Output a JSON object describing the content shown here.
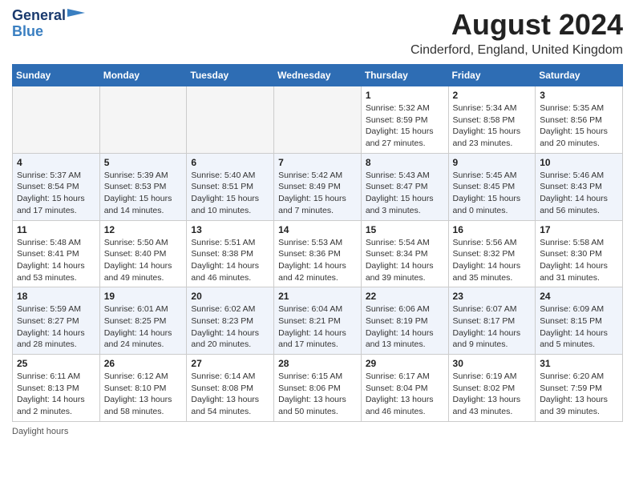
{
  "header": {
    "logo_general": "General",
    "logo_blue": "Blue",
    "main_title": "August 2024",
    "subtitle": "Cinderford, England, United Kingdom"
  },
  "days_of_week": [
    "Sunday",
    "Monday",
    "Tuesday",
    "Wednesday",
    "Thursday",
    "Friday",
    "Saturday"
  ],
  "weeks": [
    [
      {
        "day": "",
        "info": ""
      },
      {
        "day": "",
        "info": ""
      },
      {
        "day": "",
        "info": ""
      },
      {
        "day": "",
        "info": ""
      },
      {
        "day": "1",
        "info": "Sunrise: 5:32 AM\nSunset: 8:59 PM\nDaylight: 15 hours and 27 minutes."
      },
      {
        "day": "2",
        "info": "Sunrise: 5:34 AM\nSunset: 8:58 PM\nDaylight: 15 hours and 23 minutes."
      },
      {
        "day": "3",
        "info": "Sunrise: 5:35 AM\nSunset: 8:56 PM\nDaylight: 15 hours and 20 minutes."
      }
    ],
    [
      {
        "day": "4",
        "info": "Sunrise: 5:37 AM\nSunset: 8:54 PM\nDaylight: 15 hours and 17 minutes."
      },
      {
        "day": "5",
        "info": "Sunrise: 5:39 AM\nSunset: 8:53 PM\nDaylight: 15 hours and 14 minutes."
      },
      {
        "day": "6",
        "info": "Sunrise: 5:40 AM\nSunset: 8:51 PM\nDaylight: 15 hours and 10 minutes."
      },
      {
        "day": "7",
        "info": "Sunrise: 5:42 AM\nSunset: 8:49 PM\nDaylight: 15 hours and 7 minutes."
      },
      {
        "day": "8",
        "info": "Sunrise: 5:43 AM\nSunset: 8:47 PM\nDaylight: 15 hours and 3 minutes."
      },
      {
        "day": "9",
        "info": "Sunrise: 5:45 AM\nSunset: 8:45 PM\nDaylight: 15 hours and 0 minutes."
      },
      {
        "day": "10",
        "info": "Sunrise: 5:46 AM\nSunset: 8:43 PM\nDaylight: 14 hours and 56 minutes."
      }
    ],
    [
      {
        "day": "11",
        "info": "Sunrise: 5:48 AM\nSunset: 8:41 PM\nDaylight: 14 hours and 53 minutes."
      },
      {
        "day": "12",
        "info": "Sunrise: 5:50 AM\nSunset: 8:40 PM\nDaylight: 14 hours and 49 minutes."
      },
      {
        "day": "13",
        "info": "Sunrise: 5:51 AM\nSunset: 8:38 PM\nDaylight: 14 hours and 46 minutes."
      },
      {
        "day": "14",
        "info": "Sunrise: 5:53 AM\nSunset: 8:36 PM\nDaylight: 14 hours and 42 minutes."
      },
      {
        "day": "15",
        "info": "Sunrise: 5:54 AM\nSunset: 8:34 PM\nDaylight: 14 hours and 39 minutes."
      },
      {
        "day": "16",
        "info": "Sunrise: 5:56 AM\nSunset: 8:32 PM\nDaylight: 14 hours and 35 minutes."
      },
      {
        "day": "17",
        "info": "Sunrise: 5:58 AM\nSunset: 8:30 PM\nDaylight: 14 hours and 31 minutes."
      }
    ],
    [
      {
        "day": "18",
        "info": "Sunrise: 5:59 AM\nSunset: 8:27 PM\nDaylight: 14 hours and 28 minutes."
      },
      {
        "day": "19",
        "info": "Sunrise: 6:01 AM\nSunset: 8:25 PM\nDaylight: 14 hours and 24 minutes."
      },
      {
        "day": "20",
        "info": "Sunrise: 6:02 AM\nSunset: 8:23 PM\nDaylight: 14 hours and 20 minutes."
      },
      {
        "day": "21",
        "info": "Sunrise: 6:04 AM\nSunset: 8:21 PM\nDaylight: 14 hours and 17 minutes."
      },
      {
        "day": "22",
        "info": "Sunrise: 6:06 AM\nSunset: 8:19 PM\nDaylight: 14 hours and 13 minutes."
      },
      {
        "day": "23",
        "info": "Sunrise: 6:07 AM\nSunset: 8:17 PM\nDaylight: 14 hours and 9 minutes."
      },
      {
        "day": "24",
        "info": "Sunrise: 6:09 AM\nSunset: 8:15 PM\nDaylight: 14 hours and 5 minutes."
      }
    ],
    [
      {
        "day": "25",
        "info": "Sunrise: 6:11 AM\nSunset: 8:13 PM\nDaylight: 14 hours and 2 minutes."
      },
      {
        "day": "26",
        "info": "Sunrise: 6:12 AM\nSunset: 8:10 PM\nDaylight: 13 hours and 58 minutes."
      },
      {
        "day": "27",
        "info": "Sunrise: 6:14 AM\nSunset: 8:08 PM\nDaylight: 13 hours and 54 minutes."
      },
      {
        "day": "28",
        "info": "Sunrise: 6:15 AM\nSunset: 8:06 PM\nDaylight: 13 hours and 50 minutes."
      },
      {
        "day": "29",
        "info": "Sunrise: 6:17 AM\nSunset: 8:04 PM\nDaylight: 13 hours and 46 minutes."
      },
      {
        "day": "30",
        "info": "Sunrise: 6:19 AM\nSunset: 8:02 PM\nDaylight: 13 hours and 43 minutes."
      },
      {
        "day": "31",
        "info": "Sunrise: 6:20 AM\nSunset: 7:59 PM\nDaylight: 13 hours and 39 minutes."
      }
    ]
  ],
  "footer": {
    "note": "Daylight hours"
  }
}
